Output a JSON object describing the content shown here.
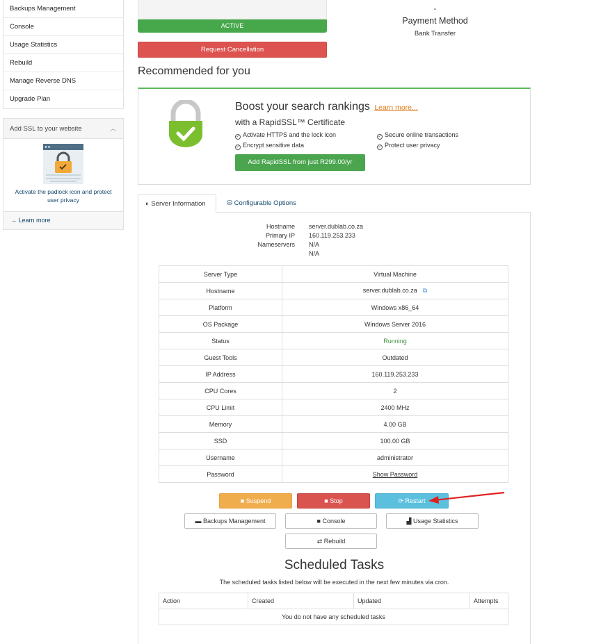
{
  "sidebar": {
    "items": [
      {
        "label": "Backups Management"
      },
      {
        "label": "Console"
      },
      {
        "label": "Usage Statistics"
      },
      {
        "label": "Rebuild"
      },
      {
        "label": "Manage Reverse DNS"
      },
      {
        "label": "Upgrade Plan"
      }
    ],
    "ssl_panel": {
      "title": "Add SSL to your website",
      "text": "Activate the padlock icon and protect user privacy",
      "learn_more": "Learn more"
    }
  },
  "status": {
    "label": "ACTIVE",
    "cancel_label": "Request Cancellation"
  },
  "payment": {
    "dash": "-",
    "label": "Payment Method",
    "value": "Bank Transfer"
  },
  "recommended": {
    "title": "Recommended for you",
    "headline": "Boost your search rankings",
    "learn_more": "Learn more...",
    "subtitle": "with a RapidSSL™ Certificate",
    "features": [
      "Activate HTTPS and the lock icon",
      "Encrypt sensitive data",
      "Secure online transactions",
      "Protect user privacy"
    ],
    "buy_label": "Add RapidSSL from just R299.00/yr"
  },
  "tabs": {
    "server_info": "Server Information",
    "config": "Configurable Options"
  },
  "summary": {
    "hostname_label": "Hostname",
    "hostname": "server.dublab.co.za",
    "ip_label": "Primary IP",
    "ip": "160.119.253.233",
    "ns_label": "Nameservers",
    "ns1": "N/A",
    "ns2": "N/A"
  },
  "info_table": [
    {
      "key": "Server Type",
      "value": "Virtual Machine"
    },
    {
      "key": "Hostname",
      "value": "server.dublab.co.za"
    },
    {
      "key": "Platform",
      "value": "Windows x86_64"
    },
    {
      "key": "OS Package",
      "value": "Windows Server 2016"
    },
    {
      "key": "Status",
      "value": "Running"
    },
    {
      "key": "Guest Tools",
      "value": "Outdated"
    },
    {
      "key": "IP Address",
      "value": "160.119.253.233"
    },
    {
      "key": "CPU Cores",
      "value": "2"
    },
    {
      "key": "CPU Limit",
      "value": "2400 MHz"
    },
    {
      "key": "Memory",
      "value": "4.00 GB"
    },
    {
      "key": "SSD",
      "value": "100.00 GB"
    },
    {
      "key": "Username",
      "value": "administrator"
    },
    {
      "key": "Password",
      "value": "Show Password"
    }
  ],
  "actions": {
    "suspend": "Suspend",
    "stop": "Stop",
    "restart": "Restart",
    "backups": "Backups Management",
    "console": "Console",
    "usage": "Usage Statistics",
    "rebuild": "Rebuild"
  },
  "scheduled": {
    "title": "Scheduled Tasks",
    "description": "The scheduled tasks listed below will be executed in the next few minutes via cron.",
    "columns": [
      "Action",
      "Created",
      "Updated",
      "Attempts"
    ],
    "empty": "You do not have any scheduled tasks"
  },
  "colors": {
    "active": "#46a84b",
    "danger": "#d9534f",
    "warning": "#f0ad4e",
    "info": "#5bc0de",
    "link": "#14476d",
    "annotation_arrow": "#e02020"
  }
}
